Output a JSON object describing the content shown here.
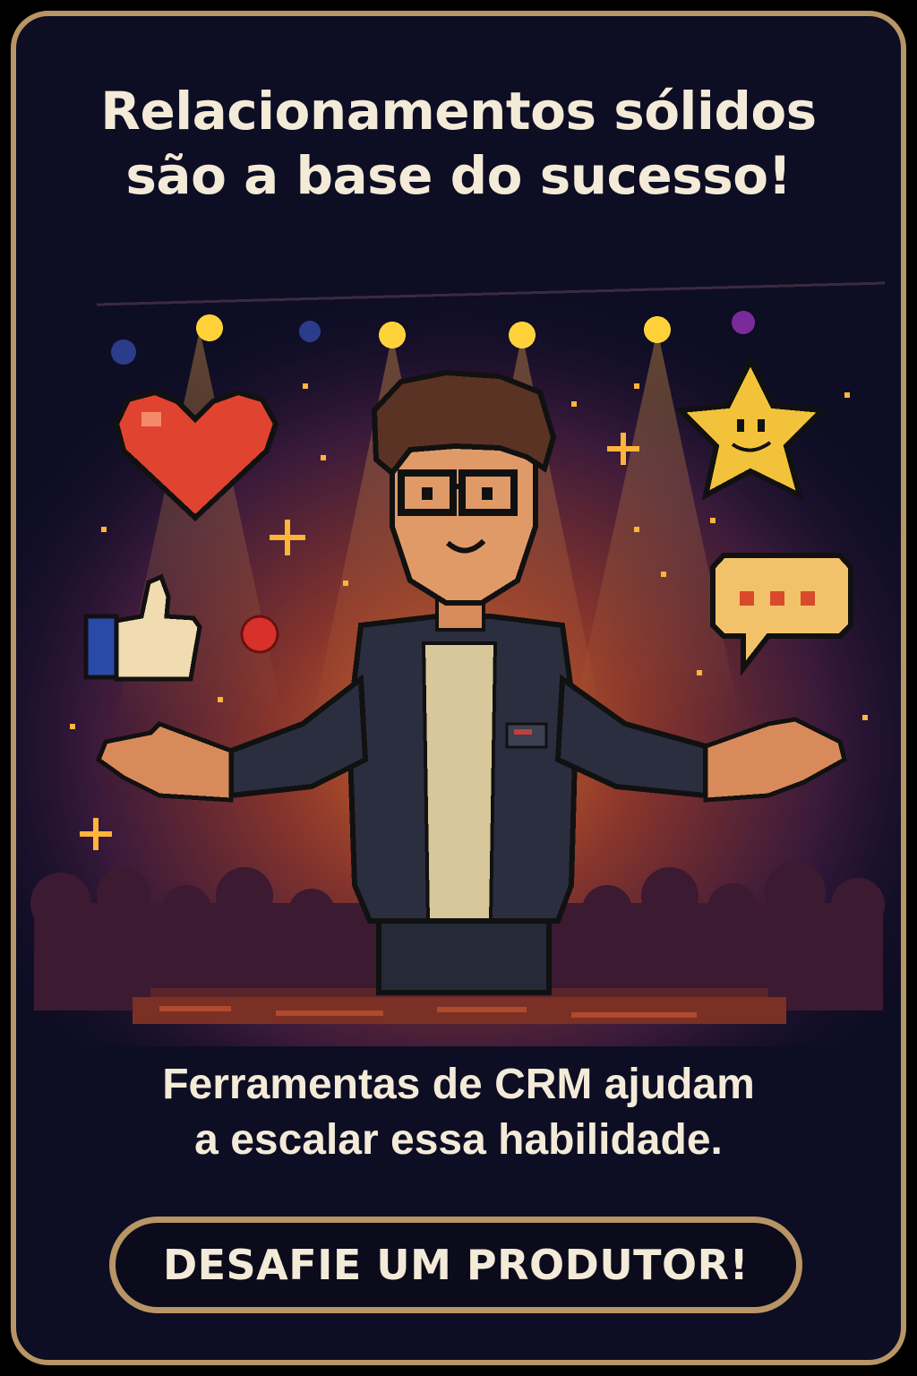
{
  "headline": {
    "line1": "Relacionamentos sólidos",
    "line2": "são a base do sucesso!"
  },
  "subline": {
    "line1": "Ferramentas de CRM ajudam",
    "line2": "a escalar essa habilidade."
  },
  "cta": {
    "label": "DESAFIE UM PRODUTOR!"
  },
  "colors": {
    "border_gold": "#b89564",
    "text_cream": "#f3ead8",
    "background_navy": "#0d0d24",
    "glow_orange": "#e8742a",
    "heart_red": "#e0432f",
    "star_yellow": "#f2c23a"
  },
  "icons": [
    "heart-icon",
    "star-icon",
    "thumbs-up-icon",
    "speech-bubble-icon",
    "sparkle-icon",
    "stage-light-icon"
  ]
}
